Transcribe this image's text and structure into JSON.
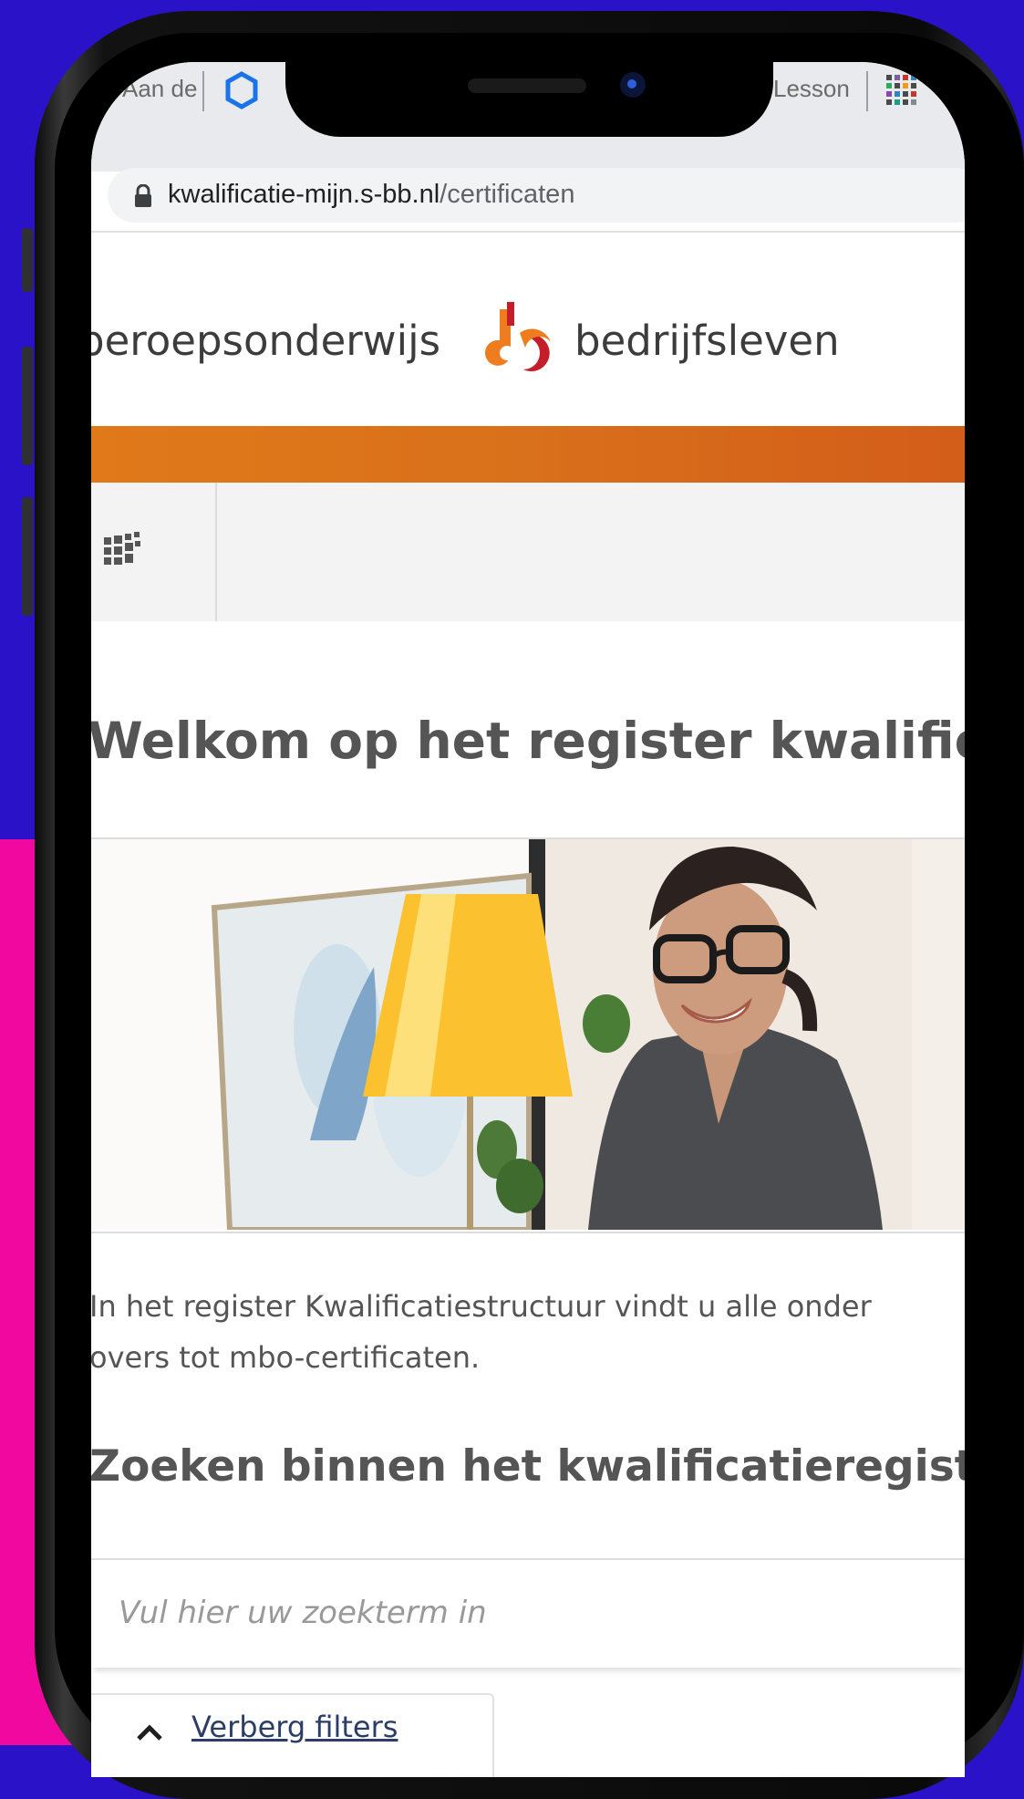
{
  "browser": {
    "tab_left_label": "Aan de",
    "tab_right_label": "Lesson",
    "url_domain": "kwalificatie-mijn.s-bb.nl",
    "url_path": "/certificaten"
  },
  "site": {
    "brand_left": "beroepsonderwijs",
    "brand_right": "bedrijfsleven",
    "colors": {
      "accent_orange": "#d9701b",
      "logo_orange": "#ee7d1f",
      "logo_red": "#c51d2a"
    }
  },
  "page": {
    "title": "Welkom op het register kwalificati",
    "intro_line1": "In het register Kwalificatiestructuur vindt u alle onder",
    "intro_line2": "overs tot mbo-certificaten.",
    "section_title": "Zoeken binnen het kwalificatieregister",
    "search_placeholder": "Vul hier uw zoekterm in",
    "filter_toggle_label": "Verberg filters"
  },
  "icons": {
    "tab": "chromium-icon",
    "tab2": "grid-icon",
    "url": "lock-icon",
    "nav": "tiles-icon",
    "filter": "chevron-up-icon"
  }
}
